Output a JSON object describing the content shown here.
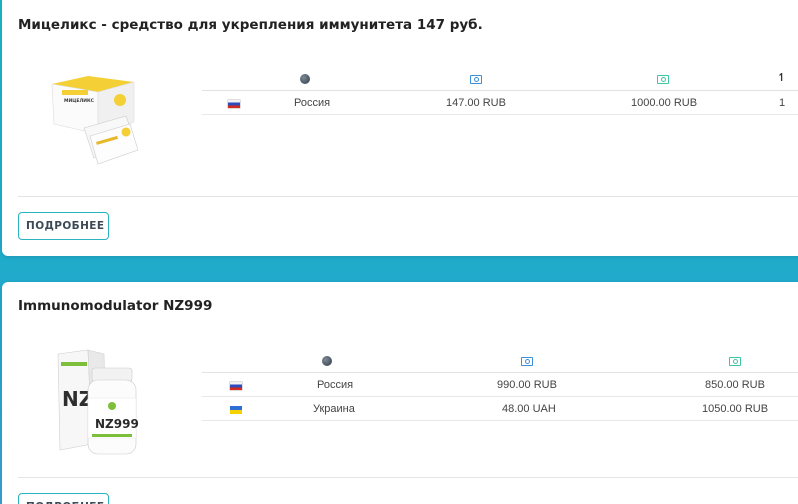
{
  "products": [
    {
      "title": "Мицеликс - средство для укрепления иммунитета 147 руб.",
      "image_label": "МИЦЕЛИКС",
      "columns": [
        "country-globe-icon",
        "price-icon",
        "old-price-icon",
        "sort-icon"
      ],
      "rows": [
        {
          "flag": "ru",
          "country": "Россия",
          "price": "147.00 RUB",
          "old_price": "1000.00 RUB",
          "qty": "1"
        }
      ],
      "button": "ПОДРОБНЕЕ"
    },
    {
      "title": "Immunomodulator NZ999",
      "image_label": "NZ999",
      "columns": [
        "country-globe-icon",
        "price-icon",
        "old-price-icon"
      ],
      "rows": [
        {
          "flag": "ru",
          "country": "Россия",
          "price": "990.00 RUB",
          "old_price": "850.00 RUB"
        },
        {
          "flag": "ua",
          "country": "Украина",
          "price": "48.00 UAH",
          "old_price": "1050.00 RUB"
        }
      ],
      "button": "ПОДРОБНЕЕ"
    }
  ],
  "colors": {
    "accent": "#2bb3c0",
    "price_icon": "#3a8fd8",
    "old_price_icon": "#3fc6a2",
    "background_gradient_start": "#1bb8c4",
    "background_gradient_end": "#3a9fd4"
  }
}
